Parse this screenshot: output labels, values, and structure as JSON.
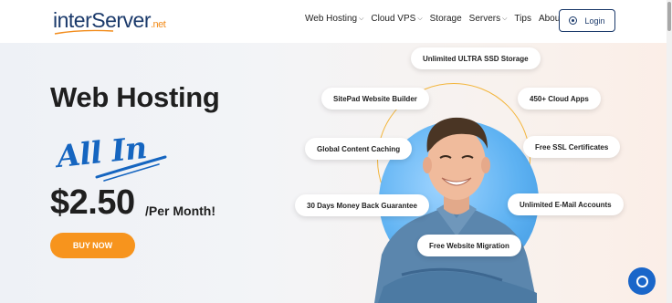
{
  "header": {
    "logo": {
      "part1": "inter",
      "part2": "Server",
      "part3": ".net"
    },
    "nav": [
      {
        "label": "Web Hosting",
        "dropdown": true,
        "name": "nav-web-hosting"
      },
      {
        "label": "Cloud VPS",
        "dropdown": true,
        "name": "nav-cloud-vps"
      },
      {
        "label": "Storage",
        "dropdown": false,
        "name": "nav-storage"
      },
      {
        "label": "Servers",
        "dropdown": true,
        "name": "nav-servers"
      },
      {
        "label": "Tips",
        "dropdown": false,
        "name": "nav-tips"
      },
      {
        "label": "About Us",
        "dropdown": true,
        "name": "nav-about-us"
      }
    ],
    "login_label": "Login"
  },
  "hero": {
    "title": "Web Hosting",
    "tagline": "All In",
    "price": "$2.50",
    "price_suffix": "/Per Month!",
    "cta_label": "BUY NOW",
    "features": [
      "Unlimited ULTRA SSD Storage",
      "SitePad Website Builder",
      "450+ Cloud Apps",
      "Global Content Caching",
      "Free SSL Certificates",
      "30 Days Money Back Guarantee",
      "Unlimited E-Mail Accounts",
      "Free Website Migration"
    ]
  },
  "colors": {
    "brand_navy": "#1b3a6b",
    "brand_orange": "#f7941d",
    "accent_blue": "#1565c0",
    "chat_blue": "#1a66c9"
  },
  "icons": {
    "login": "user-circle-icon",
    "chat": "chat-bubble-icon"
  }
}
